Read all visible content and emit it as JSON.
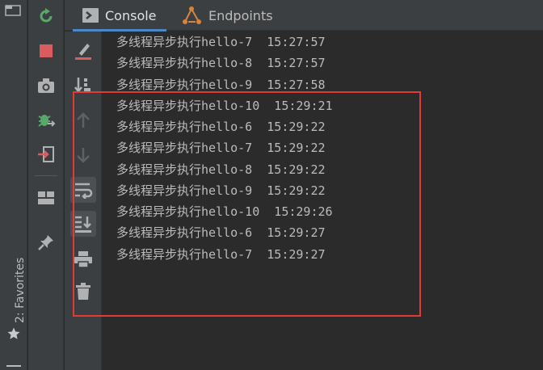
{
  "tabs": [
    {
      "label": "Console",
      "icon": "console-icon",
      "active": true
    },
    {
      "label": "Endpoints",
      "icon": "endpoints-icon",
      "active": false
    }
  ],
  "favorites": {
    "label": "2: Favorites",
    "icon": "star-icon"
  },
  "run_toolbar": [
    "rerun-icon",
    "stop-icon",
    "camera-icon",
    "debug-attach-icon",
    "exit-icon",
    "layout-icon",
    "pin-icon"
  ],
  "console_toolbar": [
    "clear-icon",
    "sort-icon",
    "up-arrow-icon",
    "down-arrow-icon",
    "soft-wrap-icon",
    "scroll-to-end-icon",
    "print-icon",
    "trash-icon"
  ],
  "log_lines": [
    "多线程异步执行hello-7  15:27:57",
    "多线程异步执行hello-8  15:27:57",
    "多线程异步执行hello-9  15:27:58",
    "多线程异步执行hello-10  15:29:21",
    "多线程异步执行hello-6  15:29:22",
    "多线程异步执行hello-7  15:29:22",
    "多线程异步执行hello-8  15:29:22",
    "多线程异步执行hello-9  15:29:22",
    "多线程异步执行hello-10  15:29:26",
    "多线程异步执行hello-6  15:29:27",
    "多线程异步执行hello-7  15:29:27"
  ],
  "colors": {
    "accent": "#4a88c7",
    "rerun": "#59a869",
    "stop": "#db5c5c",
    "highlight": "#e53935",
    "endpoints": "#d9843b"
  }
}
